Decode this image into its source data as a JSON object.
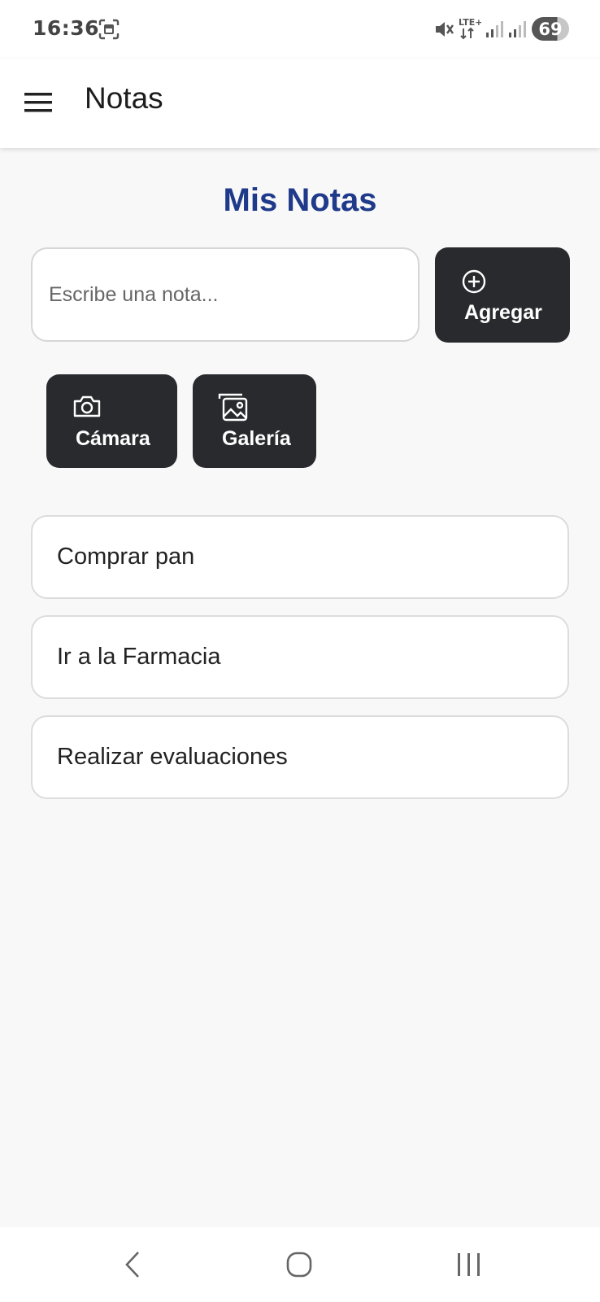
{
  "status_bar": {
    "time": "16:36",
    "network": "LTE+",
    "battery": "69",
    "battery_level": 0.69,
    "icons": [
      "screenshot-icon",
      "mute-icon",
      "lte-icon",
      "signal-icon",
      "signal-icon",
      "battery-icon"
    ]
  },
  "app_bar": {
    "title": "Notas",
    "menu_icon": "hamburger-menu-icon"
  },
  "main": {
    "heading": "Mis Notas",
    "heading_color": "#1f3a8a",
    "input": {
      "placeholder": "Escribe una nota...",
      "value": ""
    },
    "add_button": {
      "label": "Agregar",
      "icon": "plus-circle-icon"
    },
    "camera_button": {
      "label": "Cámara",
      "icon": "camera-icon"
    },
    "gallery_button": {
      "label": "Galería",
      "icon": "gallery-icon"
    },
    "notes": [
      {
        "text": "Comprar pan"
      },
      {
        "text": "Ir a la Farmacia"
      },
      {
        "text": "Realizar evaluaciones"
      }
    ],
    "button_color": "#282a2e"
  },
  "nav_bar": {
    "icons": [
      "back-icon",
      "home-icon",
      "recents-icon"
    ]
  }
}
